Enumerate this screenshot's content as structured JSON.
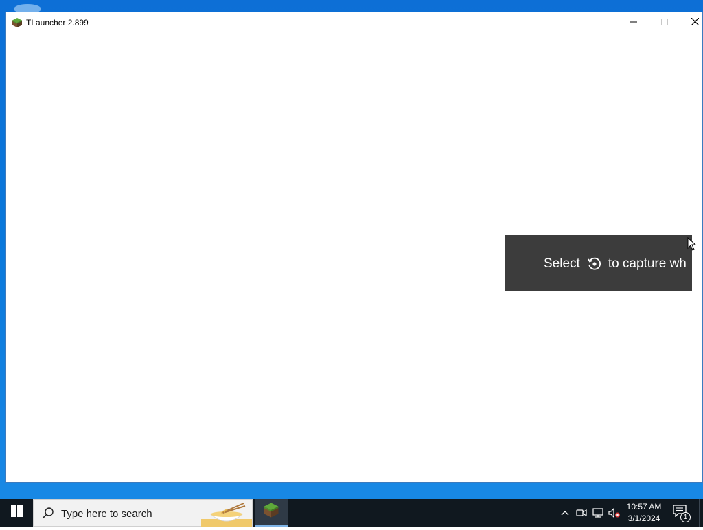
{
  "window": {
    "title": "TLauncher 2.899",
    "icon": "minecraft-grass-block-icon",
    "controls": [
      "minimize-icon",
      "maximize-icon",
      "close-icon"
    ]
  },
  "toast": {
    "text_before": "Select",
    "icon": "capture-icon",
    "text_after": "to capture wh"
  },
  "taskbar": {
    "start_icon": "windows-logo-icon",
    "search_placeholder": "Type here to search",
    "pinned_app_icon": "minecraft-grass-block-icon",
    "tray_icons": [
      "chevron-up-icon",
      "meet-now-icon",
      "network-icon",
      "volume-muted-icon"
    ],
    "clock": {
      "time": "10:57 AM",
      "date": "3/1/2024"
    },
    "notifications_count": "1"
  },
  "colors": {
    "desktop": "#0a78db",
    "taskbar": "#10181f",
    "toast_bg": "#3c3c3c",
    "window_bg": "#ffffff"
  }
}
